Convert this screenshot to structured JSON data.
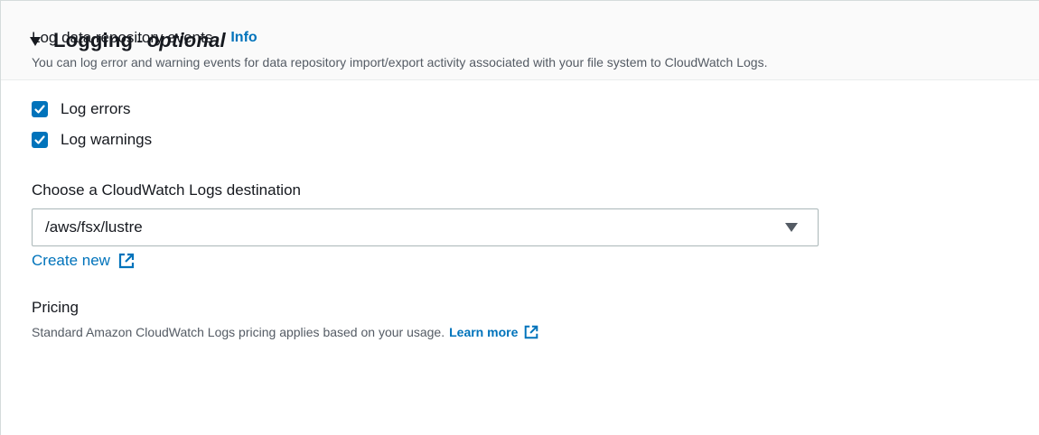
{
  "header": {
    "title": "Logging",
    "separator": "-",
    "optional": "optional"
  },
  "repository_events": {
    "label": "Log data repository events",
    "info_link": "Info",
    "description": "You can log error and warning events for data repository import/export activity associated with your file system to CloudWatch Logs.",
    "checkboxes": [
      {
        "label": "Log errors",
        "checked": true
      },
      {
        "label": "Log warnings",
        "checked": true
      }
    ]
  },
  "destination": {
    "label": "Choose a CloudWatch Logs destination",
    "selected_value": "/aws/fsx/lustre",
    "create_new_link": "Create new"
  },
  "pricing": {
    "label": "Pricing",
    "description": "Standard Amazon CloudWatch Logs pricing applies based on your usage.",
    "learn_more_link": "Learn more"
  },
  "colors": {
    "accent": "#0073bb",
    "text": "#16191f",
    "secondary_text": "#545b64",
    "header_bg": "#fafafa"
  },
  "icons": {
    "expand": "caret-down-icon",
    "checkbox": "check-icon",
    "dropdown": "caret-down-icon",
    "external": "external-link-icon"
  }
}
